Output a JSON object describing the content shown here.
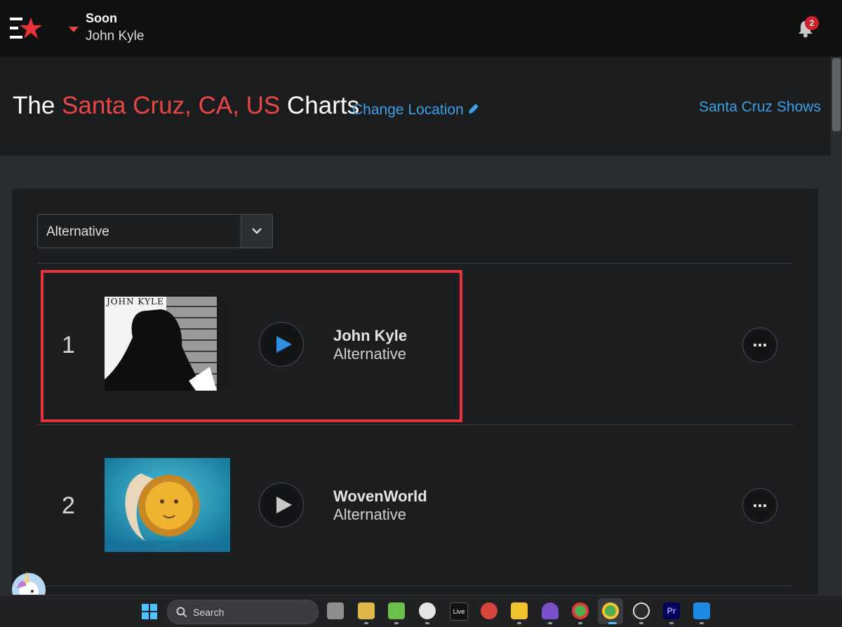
{
  "topbar": {
    "player_status": "Soon",
    "player_artist": "John Kyle",
    "notification_count": "2"
  },
  "header": {
    "title_prefix": "The",
    "location": "Santa Cruz, CA, US",
    "title_suffix": "Charts",
    "change_location": "Change Location",
    "shows_link": "Santa Cruz Shows"
  },
  "chart": {
    "genre_select": "Alternative",
    "entries": [
      {
        "rank": "1",
        "artist": "John Kyle",
        "genre": "Alternative",
        "cover_text": "JOHN KYLE"
      },
      {
        "rank": "2",
        "artist": "WovenWorld",
        "genre": "Alternative"
      }
    ]
  },
  "taskbar": {
    "search_label": "Search",
    "live_label": "Live",
    "premiere_label": "Pr"
  },
  "colors": {
    "accent_red": "#e84545",
    "link_blue": "#3aa0e8",
    "highlight": "#e8333a"
  }
}
